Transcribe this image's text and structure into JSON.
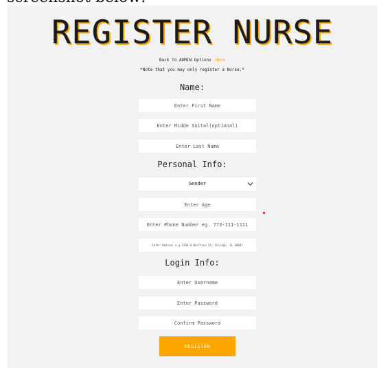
{
  "top_caption": "screenshot below:",
  "page": {
    "title": "REGISTER NURSE",
    "back_text": "Back To ADMIN Options",
    "back_link": "Here",
    "note": "*Note that you may only register a Nurse.*"
  },
  "sections": {
    "name": "Name:",
    "personal": "Personal Info:",
    "login": "Login Info:"
  },
  "fields": {
    "first_name": "Enter First Name",
    "middle_initial": "Enter Midde Inital(optional)",
    "last_name": "Enter Last Name",
    "gender": "Gender",
    "age": "Enter Age",
    "phone": "Enter Phone Number eg. 773-111-1111",
    "address": "Enter Address e.g 1200 W Harrison St, Chicago, IL 60607",
    "username": "Enter Username",
    "password": "Enter Password",
    "confirm_password": "Confirm Password"
  },
  "button": {
    "register": "REGISTER"
  },
  "colors": {
    "accent": "#ffa500",
    "panel": "#f2f2f2",
    "title_shadow": "#f5a300"
  },
  "icons": {
    "gender_select": "chevron-down-icon"
  }
}
